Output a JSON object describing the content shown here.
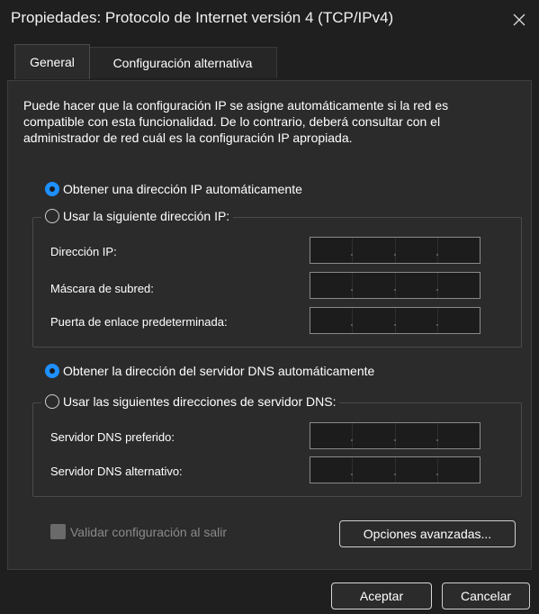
{
  "window": {
    "title": "Propiedades: Protocolo de Internet versión 4 (TCP/IPv4)",
    "close_icon": "close-icon"
  },
  "tabs": [
    {
      "label": "General",
      "active": true
    },
    {
      "label": "Configuración alternativa",
      "active": false
    }
  ],
  "description": "Puede hacer que la configuración IP se asigne automáticamente si la red es compatible con esta funcionalidad. De lo contrario, deberá consultar con el administrador de red cuál es la configuración IP apropiada.",
  "ip_section": {
    "auto_radio": {
      "label": "Obtener una dirección IP automáticamente",
      "checked": true
    },
    "manual_radio": {
      "label": "Usar la siguiente dirección IP:",
      "checked": false
    },
    "fields": [
      {
        "label": "Dirección IP:",
        "value": [
          "",
          "",
          "",
          ""
        ]
      },
      {
        "label": "Máscara de subred:",
        "value": [
          "",
          "",
          "",
          ""
        ]
      },
      {
        "label": "Puerta de enlace predeterminada:",
        "value": [
          "",
          "",
          "",
          ""
        ]
      }
    ]
  },
  "dns_section": {
    "auto_radio": {
      "label": "Obtener la dirección del servidor DNS automáticamente",
      "checked": true
    },
    "manual_radio": {
      "label": "Usar las siguientes direcciones de servidor DNS:",
      "checked": false
    },
    "fields": [
      {
        "label": "Servidor DNS preferido:",
        "value": [
          "",
          "",
          "",
          ""
        ]
      },
      {
        "label": "Servidor DNS alternativo:",
        "value": [
          "",
          "",
          "",
          ""
        ]
      }
    ]
  },
  "validate_checkbox": {
    "label": "Validar configuración al salir",
    "checked": false,
    "enabled": false
  },
  "buttons": {
    "advanced": "Opciones avanzadas...",
    "ok": "Aceptar",
    "cancel": "Cancelar"
  },
  "colors": {
    "background": "#1f1f1f",
    "panel": "#2b2b2b",
    "accent": "#1e90ff",
    "text": "#ffffff",
    "disabled_text": "#8a8a8a"
  }
}
